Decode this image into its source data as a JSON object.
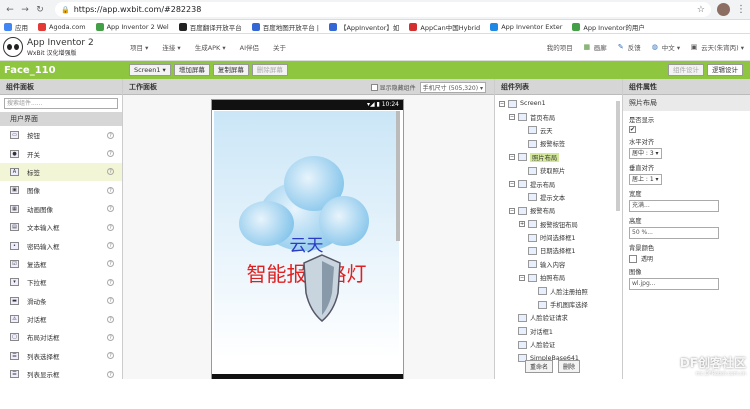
{
  "browser": {
    "url": "https://app.wxbit.com/#282238",
    "bookmarks": [
      "应用",
      "Agoda.com",
      "App Inventor 2 Wel",
      "百度翻译开放平台",
      "百度地图开放平台 |",
      "【AppInventor】如",
      "AppCan中国Hybrid",
      "App Inventor Exter",
      "App Inventor的用户"
    ]
  },
  "header": {
    "logo_title": "App Inventor 2",
    "logo_sub": "WxBit 汉化增强版",
    "menu": [
      "项目 ▾",
      "连接 ▾",
      "生成APK ▾",
      "AI伴侣",
      "关于"
    ],
    "right": [
      "我的项目",
      "画廊",
      "反馈",
      "中文 ▾",
      "云天(朱宵丙) ▾"
    ]
  },
  "toolbar": {
    "project_name": "Face_110",
    "screen_select": "Screen1 ▾",
    "add_screen": "增加屏幕",
    "copy_screen": "复制屏幕",
    "delete_screen": "删除屏幕",
    "designer": "组件设计",
    "blocks": "逻辑设计"
  },
  "palette": {
    "title": "组件面板",
    "search_placeholder": "搜索组件......",
    "category": "用户界面",
    "items": [
      "按钮",
      "开关",
      "标签",
      "图像",
      "动画图像",
      "文本输入框",
      "密码输入框",
      "复选框",
      "下拉框",
      "滑动条",
      "对话框",
      "布局对话框",
      "列表选择框",
      "列表显示框"
    ]
  },
  "workspace": {
    "title": "工作面板",
    "show_hidden": "显示隐藏组件",
    "device_size": "手机尺寸 (505,320) ▾",
    "time": "10:24",
    "screen_title1": "云天",
    "screen_title2": "智能报警路灯"
  },
  "tree": {
    "title": "组件列表",
    "nodes": [
      {
        "label": "Screen1",
        "level": 0,
        "exp": "⊟"
      },
      {
        "label": "首页布局",
        "level": 1,
        "exp": "⊟"
      },
      {
        "label": "云天",
        "level": 2,
        "exp": ""
      },
      {
        "label": "报警标签",
        "level": 2,
        "exp": ""
      },
      {
        "label": "照片布局",
        "level": 1,
        "exp": "⊟",
        "sel": true
      },
      {
        "label": "获取照片",
        "level": 2,
        "exp": ""
      },
      {
        "label": "提示布局",
        "level": 1,
        "exp": "⊟"
      },
      {
        "label": "提示文本",
        "level": 2,
        "exp": ""
      },
      {
        "label": "报警布局",
        "level": 1,
        "exp": "⊟"
      },
      {
        "label": "报警按钮布局",
        "level": 2,
        "exp": "⊞"
      },
      {
        "label": "时间选择框1",
        "level": 2,
        "exp": ""
      },
      {
        "label": "日期选择框1",
        "level": 2,
        "exp": ""
      },
      {
        "label": "输入内容",
        "level": 2,
        "exp": ""
      },
      {
        "label": "拍照布局",
        "level": 2,
        "exp": "⊟"
      },
      {
        "label": "人脸注册拍照",
        "level": 3,
        "exp": ""
      },
      {
        "label": "手机图库选择",
        "level": 3,
        "exp": ""
      },
      {
        "label": "人脸验证请求",
        "level": 1,
        "exp": ""
      },
      {
        "label": "对话框1",
        "level": 1,
        "exp": ""
      },
      {
        "label": "人脸验证",
        "level": 1,
        "exp": ""
      },
      {
        "label": "SimpleBase641",
        "level": 1,
        "exp": ""
      }
    ],
    "rename": "重命名",
    "delete": "删除"
  },
  "props": {
    "title": "组件属性",
    "component": "照片布局",
    "visible_label": "是否显示",
    "visible_check": "✔",
    "halign_label": "水平对齐",
    "halign_value": "居中 : 3 ▾",
    "valign_label": "垂直对齐",
    "valign_value": "居上 : 1 ▾",
    "width_label": "宽度",
    "width_value": "充满...",
    "height_label": "高度",
    "height_value": "50 %...",
    "bg_label": "背景颜色",
    "bg_value": "透明",
    "image_label": "图像",
    "image_value": "wl.jpg..."
  },
  "watermark": {
    "main": "DF创客社区",
    "sub": "mc.DFRobot.com.cn"
  },
  "colors": {
    "accent": "#8ec63f",
    "selected": "#d4e89a",
    "title_blue": "#2b3bc4",
    "title_red": "#e02020"
  }
}
